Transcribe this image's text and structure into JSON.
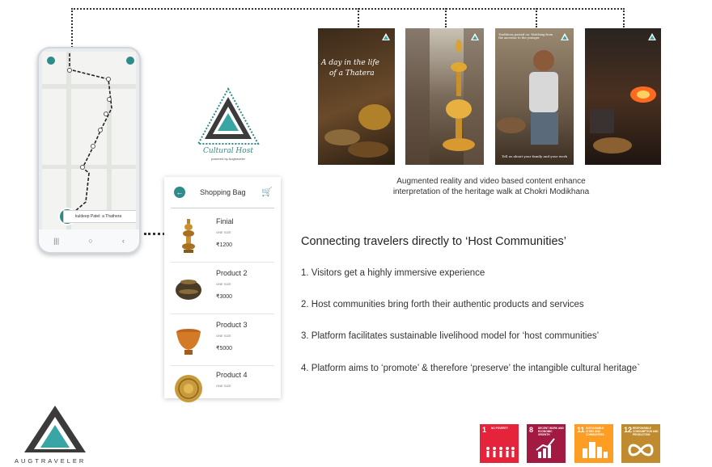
{
  "phone": {
    "tag_label": "kuldeep Patel: a Thathera"
  },
  "brand": {
    "cultural_host": "Cultural Host",
    "powered_by": "powered by Augtraveler",
    "augtraveler": "AUGTRAVELER"
  },
  "shopping_bag": {
    "title": "Shopping Bag",
    "items": [
      {
        "name": "Finial",
        "size": "ONE SIZE",
        "price": "₹1200"
      },
      {
        "name": "Product 2",
        "size": "ONE SIZE",
        "price": "₹3000"
      },
      {
        "name": "Product 3",
        "size": "ONE SIZE",
        "price": "₹5000"
      },
      {
        "name": "Product 4",
        "size": "ONE SIZE",
        "price": ""
      }
    ]
  },
  "photos": {
    "caption_1_line1": "A day in the life",
    "caption_1_line2": "of a Thatera",
    "caption_3_top": "Traditions passed on. Watching from the ancestor to the younger",
    "caption_3_bottom": "Tell us about your family and your work"
  },
  "ar_caption_line1": "Augmented reality and video based content enhance",
  "ar_caption_line2": "interpretation of the heritage walk at Chokri Modikhana",
  "headline": "Connecting travelers directly to ‘Host Communities’",
  "points": [
    "1. Visitors get a highly immersive experience",
    "2. Host communities bring forth their authentic products and services",
    "3. Platform facilitates sustainable livelihood model for ‘host communities’",
    "4. Platform aims to ‘promote’ & therefore ‘preserve’ the intangible cultural heritage`"
  ],
  "sdgs": [
    {
      "num": "1",
      "text": "NO POVERTY",
      "color": "#e5243b"
    },
    {
      "num": "8",
      "text": "DECENT WORK AND ECONOMIC GROWTH",
      "color": "#a21942"
    },
    {
      "num": "11",
      "text": "SUSTAINABLE CITIES AND COMMUNITIES",
      "color": "#fd9d24"
    },
    {
      "num": "12",
      "text": "RESPONSIBLE CONSUMPTION AND PRODUCTION",
      "color": "#bf8b2e"
    }
  ],
  "colors": {
    "accent": "#2f8a8a"
  }
}
